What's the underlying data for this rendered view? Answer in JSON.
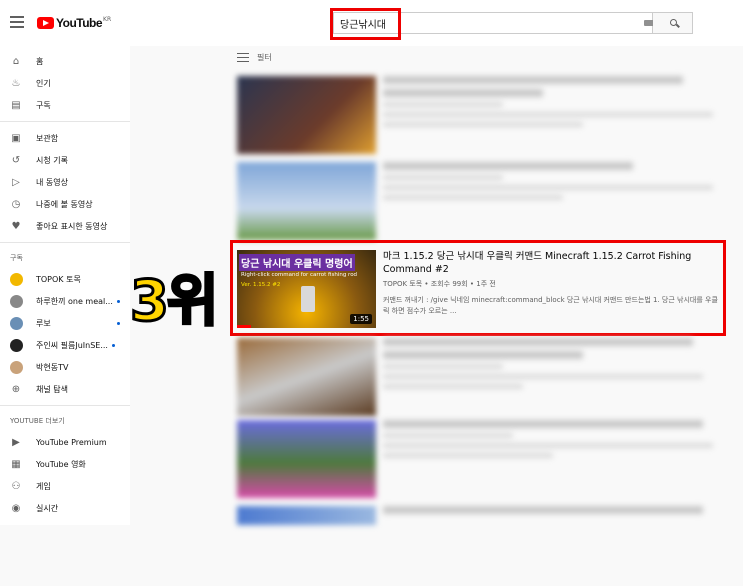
{
  "header": {
    "logo_text": "YouTube",
    "logo_region": "KR",
    "search_value": "당근낚시대"
  },
  "sidebar": {
    "main": [
      {
        "icon": "home-icon",
        "label": "홈"
      },
      {
        "icon": "fire-icon",
        "label": "인기"
      },
      {
        "icon": "subscriptions-icon",
        "label": "구독"
      }
    ],
    "library": [
      {
        "icon": "library-icon",
        "label": "보관함"
      },
      {
        "icon": "history-icon",
        "label": "시청 기록"
      },
      {
        "icon": "my-videos-icon",
        "label": "내 동영상"
      },
      {
        "icon": "watch-later-icon",
        "label": "나중에 볼 동영상"
      },
      {
        "icon": "like-icon",
        "label": "좋아요 표시한 동영상"
      }
    ],
    "subs_heading": "구독",
    "subs": [
      {
        "label": "TOPOK 토목",
        "avatar_color": "#f2b800",
        "new": false
      },
      {
        "label": "하루한끼 one meal...",
        "avatar_color": "#888888",
        "new": true
      },
      {
        "label": "루보",
        "avatar_color": "#6a8fb5",
        "new": true
      },
      {
        "label": "주인씨 필름JuInSE...",
        "avatar_color": "#222222",
        "new": true
      },
      {
        "label": "박현동TV",
        "avatar_color": "#c9a27a",
        "new": false
      },
      {
        "label": "채널 탐색",
        "avatar_color": "#606060",
        "new": false
      }
    ],
    "more_heading": "YOUTUBE 더보기",
    "more": [
      {
        "icon": "youtube-premium-icon",
        "label": "YouTube Premium"
      },
      {
        "icon": "movies-icon",
        "label": "YouTube 영화"
      },
      {
        "icon": "gaming-icon",
        "label": "게임"
      },
      {
        "icon": "live-icon",
        "label": "실시간"
      }
    ]
  },
  "main": {
    "filter_label": "필터",
    "rank_badge": "3위",
    "featured": {
      "title": "마크 1.15.2 당근 낚시대 우클릭 커맨드 Minecraft 1.15.2 Carrot Fishing Command #2",
      "subtitle": "TOPOK 토목 • 조회수 99회 • 1주 전",
      "description": "커맨드 꺼내기 : /give 닉네임 minecraft:command_block 당근 낚시대 커맨드 만드는법 1. 당근 낚시대를 우클릭 하면 점수가 오르는 ...",
      "duration": "1:55",
      "thumb_title": "당근 낚시대 우클릭 명령어",
      "thumb_sub": "Right-click command for carrot fishing rod",
      "thumb_version": "Ver. 1.15.2 #2"
    },
    "thumb_colors": [
      "#2b3550",
      "#7fa6d8",
      "#9a6b3b",
      "#4d7a3d",
      "#6b6ce0"
    ]
  }
}
